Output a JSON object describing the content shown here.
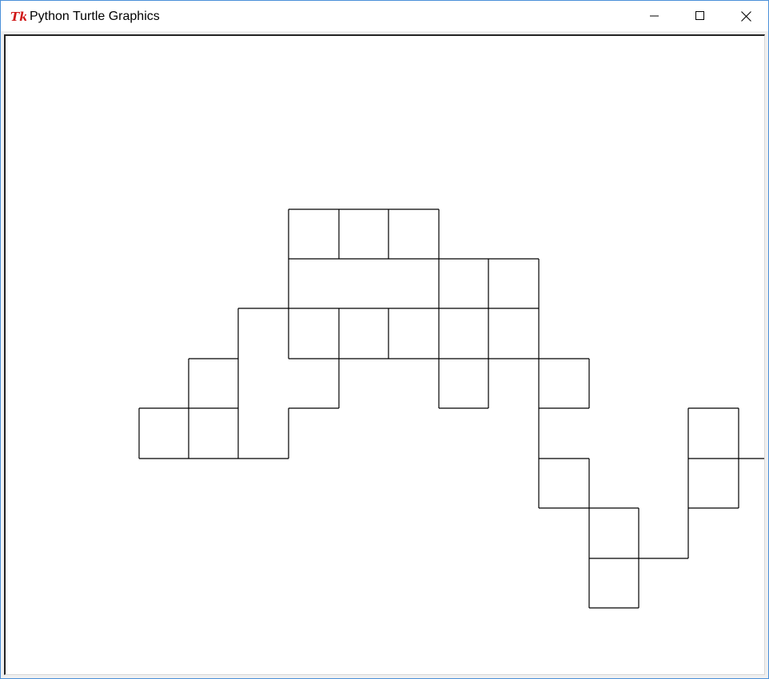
{
  "window": {
    "title": "Python Turtle Graphics",
    "app_icon": "tk-icon",
    "controls": [
      "minimize-icon",
      "maximize-icon",
      "close-icon"
    ]
  },
  "canvas": {
    "background": "#ffffff",
    "stroke_color": "#000000"
  }
}
